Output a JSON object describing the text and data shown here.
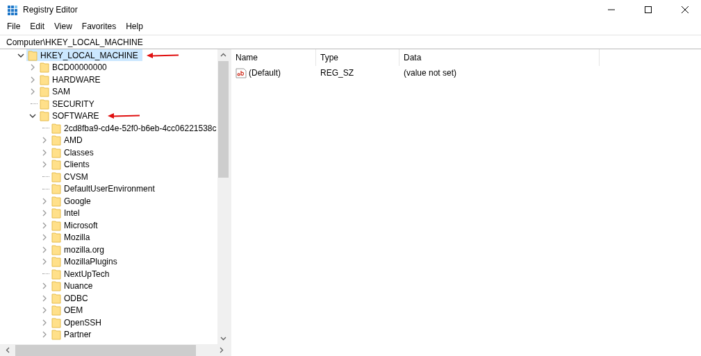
{
  "window": {
    "title": "Registry Editor"
  },
  "menu": [
    "File",
    "Edit",
    "View",
    "Favorites",
    "Help"
  ],
  "address": "Computer\\HKEY_LOCAL_MACHINE",
  "tree": [
    {
      "label": "HKEY_LOCAL_MACHINE",
      "expandable": true,
      "expanded": true,
      "selected": true,
      "arrow": true,
      "children": [
        {
          "label": "BCD00000000",
          "expandable": true,
          "expanded": false,
          "selected": false,
          "arrow": false
        },
        {
          "label": "HARDWARE",
          "expandable": true,
          "expanded": false,
          "selected": false,
          "arrow": false
        },
        {
          "label": "SAM",
          "expandable": true,
          "expanded": false,
          "selected": false,
          "arrow": false
        },
        {
          "label": "SECURITY",
          "expandable": false,
          "expanded": false,
          "selected": false,
          "arrow": false
        },
        {
          "label": "SOFTWARE",
          "expandable": true,
          "expanded": true,
          "selected": false,
          "arrow": true,
          "children": [
            {
              "label": "2cd8fba9-cd4e-52f0-b6eb-4cc06221538c",
              "expandable": false,
              "expanded": false,
              "selected": false,
              "arrow": false
            },
            {
              "label": "AMD",
              "expandable": true,
              "expanded": false,
              "selected": false,
              "arrow": false
            },
            {
              "label": "Classes",
              "expandable": true,
              "expanded": false,
              "selected": false,
              "arrow": false
            },
            {
              "label": "Clients",
              "expandable": true,
              "expanded": false,
              "selected": false,
              "arrow": false
            },
            {
              "label": "CVSM",
              "expandable": false,
              "expanded": false,
              "selected": false,
              "arrow": false
            },
            {
              "label": "DefaultUserEnvironment",
              "expandable": false,
              "expanded": false,
              "selected": false,
              "arrow": false
            },
            {
              "label": "Google",
              "expandable": true,
              "expanded": false,
              "selected": false,
              "arrow": false
            },
            {
              "label": "Intel",
              "expandable": true,
              "expanded": false,
              "selected": false,
              "arrow": false
            },
            {
              "label": "Microsoft",
              "expandable": true,
              "expanded": false,
              "selected": false,
              "arrow": false
            },
            {
              "label": "Mozilla",
              "expandable": true,
              "expanded": false,
              "selected": false,
              "arrow": false
            },
            {
              "label": "mozilla.org",
              "expandable": true,
              "expanded": false,
              "selected": false,
              "arrow": false
            },
            {
              "label": "MozillaPlugins",
              "expandable": true,
              "expanded": false,
              "selected": false,
              "arrow": false
            },
            {
              "label": "NextUpTech",
              "expandable": false,
              "expanded": false,
              "selected": false,
              "arrow": false
            },
            {
              "label": "Nuance",
              "expandable": true,
              "expanded": false,
              "selected": false,
              "arrow": false
            },
            {
              "label": "ODBC",
              "expandable": true,
              "expanded": false,
              "selected": false,
              "arrow": false
            },
            {
              "label": "OEM",
              "expandable": true,
              "expanded": false,
              "selected": false,
              "arrow": false
            },
            {
              "label": "OpenSSH",
              "expandable": true,
              "expanded": false,
              "selected": false,
              "arrow": false
            },
            {
              "label": "Partner",
              "expandable": true,
              "expanded": false,
              "selected": false,
              "arrow": false
            }
          ]
        }
      ]
    }
  ],
  "values": {
    "columns": [
      "Name",
      "Type",
      "Data"
    ],
    "rows": [
      {
        "name": "(Default)",
        "type": "REG_SZ",
        "data": "(value not set)"
      }
    ]
  }
}
